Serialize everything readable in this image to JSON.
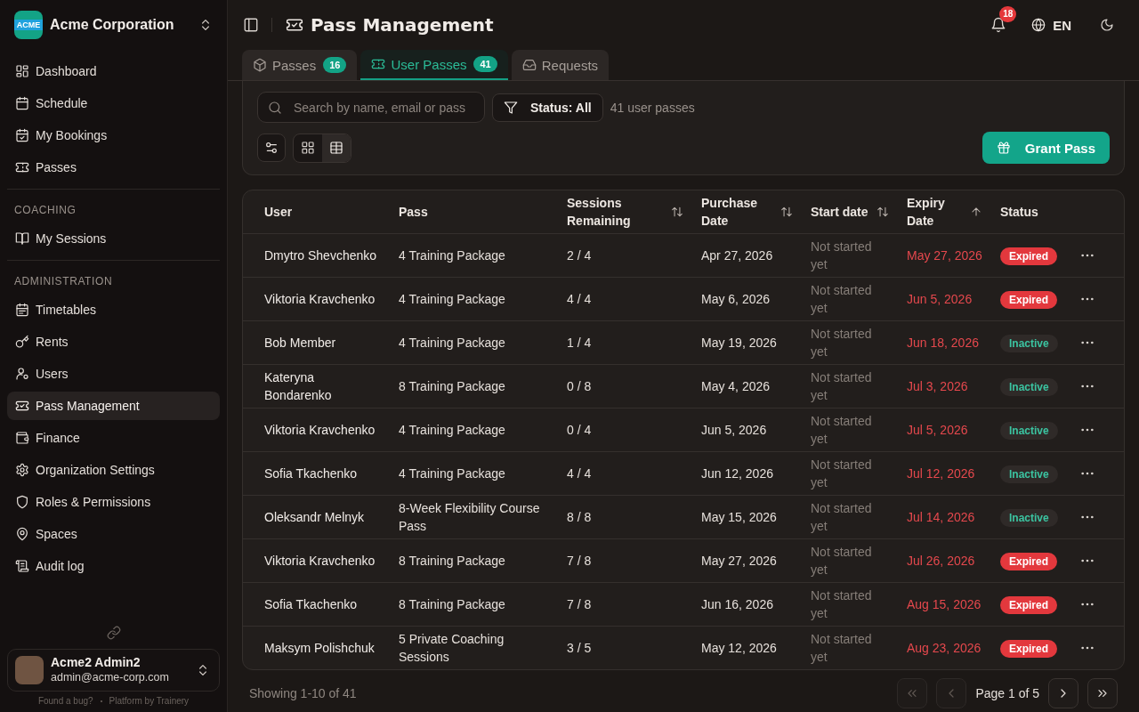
{
  "sidebar": {
    "organization": {
      "logo_text": "ACME",
      "name": "Acme Corporation"
    },
    "sections": [
      {
        "items": [
          {
            "label": "Dashboard",
            "selected": false
          },
          {
            "label": "Schedule",
            "selected": false
          },
          {
            "label": "My Bookings",
            "selected": false
          },
          {
            "label": "Passes",
            "selected": false
          }
        ]
      },
      {
        "heading": "COACHING",
        "items": [
          {
            "label": "My Sessions",
            "selected": false
          }
        ]
      },
      {
        "heading": "ADMINISTRATION",
        "items": [
          {
            "label": "Timetables",
            "selected": false
          },
          {
            "label": "Rents",
            "selected": false
          },
          {
            "label": "Users",
            "selected": false
          },
          {
            "label": "Pass Management",
            "selected": true
          },
          {
            "label": "Finance",
            "selected": false
          },
          {
            "label": "Organization Settings",
            "selected": false
          },
          {
            "label": "Roles & Permissions",
            "selected": false
          },
          {
            "label": "Spaces",
            "selected": false
          },
          {
            "label": "Audit log",
            "selected": false
          }
        ]
      }
    ],
    "user": {
      "name": "Acme2 Admin2",
      "email": "admin@acme-corp.com"
    },
    "footer_links": [
      "Found a bug?",
      "Platform by Trainery"
    ]
  },
  "header": {
    "title": "Pass Management",
    "notification_count": "18",
    "language": "EN"
  },
  "tabs": [
    {
      "label": "Passes",
      "count": "16",
      "selected": false
    },
    {
      "label": "User Passes",
      "count": "41",
      "selected": true
    },
    {
      "label": "Requests",
      "selected": false
    }
  ],
  "toolbar": {
    "search": {
      "placeholder": "Search by name, email or pass"
    },
    "status_filter": "Status: All",
    "result_count": "41 user passes",
    "view_modes": [
      {
        "selected": false
      },
      {
        "selected": true
      }
    ],
    "grant_button": "Grant Pass"
  },
  "table": {
    "columns": [
      {
        "label": "User"
      },
      {
        "label": "Pass"
      },
      {
        "label": "Sessions Remaining",
        "sortable": true,
        "sorted": false
      },
      {
        "label": "Purchase Date",
        "sortable": true,
        "sorted": false
      },
      {
        "label": "Start date",
        "sortable": true,
        "sorted": false
      },
      {
        "label": "Expiry Date",
        "sortable": true,
        "sorted": true
      },
      {
        "label": "Status"
      }
    ],
    "rows": [
      {
        "user": "Dmytro Shevchenko",
        "pass": "4 Training Package",
        "sessions": "2 / 4",
        "purchase_date": "Apr 27, 2026",
        "start_date": "Not started yet",
        "expiry_date": "May 27, 2026",
        "status": {
          "label": "Expired",
          "kind": "expired"
        }
      },
      {
        "user": "Viktoria Kravchenko",
        "pass": "4 Training Package",
        "sessions": "4 / 4",
        "purchase_date": "May 6, 2026",
        "start_date": "Not started yet",
        "expiry_date": "Jun 5, 2026",
        "status": {
          "label": "Expired",
          "kind": "expired"
        }
      },
      {
        "user": "Bob Member",
        "pass": "4 Training Package",
        "sessions": "1 / 4",
        "purchase_date": "May 19, 2026",
        "start_date": "Not started yet",
        "expiry_date": "Jun 18, 2026",
        "status": {
          "label": "Inactive",
          "kind": "inactive"
        }
      },
      {
        "user": "Kateryna Bondarenko",
        "pass": "8 Training Package",
        "sessions": "0 / 8",
        "purchase_date": "May 4, 2026",
        "start_date": "Not started yet",
        "expiry_date": "Jul 3, 2026",
        "status": {
          "label": "Inactive",
          "kind": "inactive"
        }
      },
      {
        "user": "Viktoria Kravchenko",
        "pass": "4 Training Package",
        "sessions": "0 / 4",
        "purchase_date": "Jun 5, 2026",
        "start_date": "Not started yet",
        "expiry_date": "Jul 5, 2026",
        "status": {
          "label": "Inactive",
          "kind": "inactive"
        }
      },
      {
        "user": "Sofia Tkachenko",
        "pass": "4 Training Package",
        "sessions": "4 / 4",
        "purchase_date": "Jun 12, 2026",
        "start_date": "Not started yet",
        "expiry_date": "Jul 12, 2026",
        "status": {
          "label": "Inactive",
          "kind": "inactive"
        }
      },
      {
        "user": "Oleksandr Melnyk",
        "pass": "8-Week Flexibility Course Pass",
        "sessions": "8 / 8",
        "purchase_date": "May 15, 2026",
        "start_date": "Not started yet",
        "expiry_date": "Jul 14, 2026",
        "status": {
          "label": "Inactive",
          "kind": "inactive"
        }
      },
      {
        "user": "Viktoria Kravchenko",
        "pass": "8 Training Package",
        "sessions": "7 / 8",
        "purchase_date": "May 27, 2026",
        "start_date": "Not started yet",
        "expiry_date": "Jul 26, 2026",
        "status": {
          "label": "Expired",
          "kind": "expired"
        }
      },
      {
        "user": "Sofia Tkachenko",
        "pass": "8 Training Package",
        "sessions": "7 / 8",
        "purchase_date": "Jun 16, 2026",
        "start_date": "Not started yet",
        "expiry_date": "Aug 15, 2026",
        "status": {
          "label": "Expired",
          "kind": "expired"
        }
      },
      {
        "user": "Maksym Polishchuk",
        "pass": "5 Private Coaching Sessions",
        "sessions": "3 / 5",
        "purchase_date": "May 12, 2026",
        "start_date": "Not started yet",
        "expiry_date": "Aug 23, 2026",
        "status": {
          "label": "Expired",
          "kind": "expired"
        }
      }
    ]
  },
  "pagination": {
    "summary": "Showing 1-10 of 41",
    "page_label": "Page 1 of 5",
    "buttons": [
      {
        "kind": "first",
        "disabled": true
      },
      {
        "kind": "prev",
        "disabled": true
      },
      {
        "kind": "next",
        "disabled": false
      },
      {
        "kind": "last",
        "disabled": false
      }
    ]
  }
}
